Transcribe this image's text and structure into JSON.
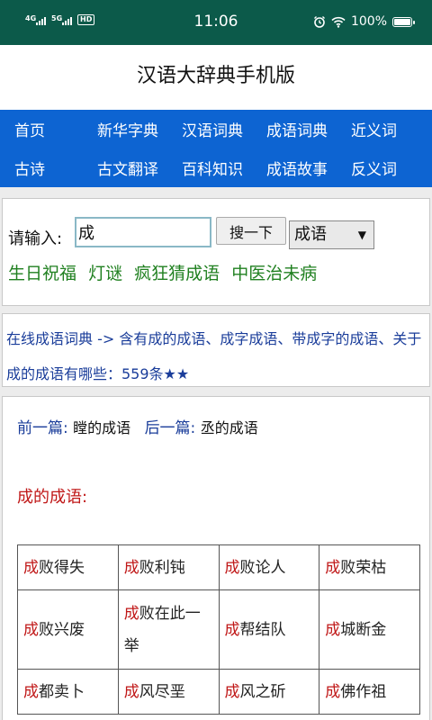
{
  "status": {
    "signal1_label": "4G",
    "signal2_label": "5G",
    "hd_label": "HD",
    "time": "11:06",
    "battery": "100%"
  },
  "app_title": "汉语大辞典手机版",
  "nav": {
    "row1": [
      "首页",
      "新华字典",
      "汉语词典",
      "成语词典",
      "近义词"
    ],
    "row2": [
      "古诗",
      "古文翻译",
      "百科知识",
      "成语故事",
      "反义词"
    ]
  },
  "search": {
    "label": "请输入:",
    "value": "成",
    "button": "搜一下",
    "select_value": "成语",
    "links": [
      "生日祝福",
      "灯谜",
      "疯狂猜成语",
      "中医治未病"
    ]
  },
  "info": {
    "text": "在线成语词典 -> 含有成的成语、成字成语、带成字的成语、关于成的成语有哪些：559条★★"
  },
  "content": {
    "prev_label": "前一篇:",
    "prev_link": "瞠的成语",
    "next_label": "后一篇:",
    "next_link": "丞的成语",
    "section_title": "成的成语:",
    "highlight_char": "成",
    "rows": [
      [
        "败得失",
        "败利钝",
        "败论人",
        "败荣枯"
      ],
      [
        "败兴废",
        "败在此一举",
        "帮结队",
        "城断金"
      ],
      [
        "都卖卜",
        "风尽垩",
        "风之斫",
        "佛作祖"
      ]
    ]
  }
}
